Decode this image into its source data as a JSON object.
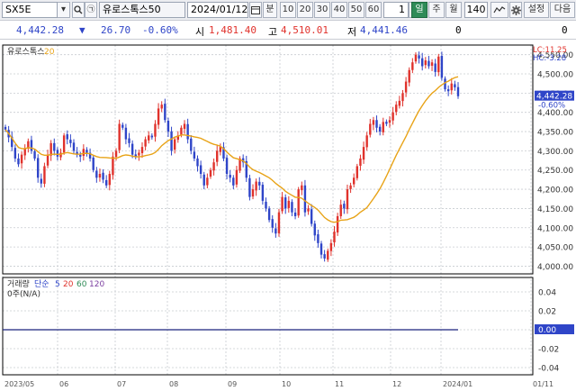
{
  "toolbar": {
    "symbol": "SX5E",
    "name": "유로스톡스50",
    "date": "2024/01/12",
    "period_label": "분",
    "intervals": [
      "10",
      "20",
      "30",
      "40",
      "50",
      "60"
    ],
    "count_value": "1",
    "period_tabs": [
      "일",
      "주",
      "월"
    ],
    "active_tab": "일",
    "bar_count": "140",
    "settings_label": "설정",
    "next_label": "다음"
  },
  "quote": {
    "price": "4,442.28",
    "change_arrow": "▼",
    "change": "26.70",
    "change_pct": "-0.60%",
    "open_label": "시",
    "open": "1,481.40",
    "high_label": "고",
    "high": "4,510.01",
    "low_label": "저",
    "low": "4,441.46",
    "volume_1": "0",
    "volume_2": "0"
  },
  "chart": {
    "legend_name": "유로스톡스",
    "legend_ma": "20",
    "lc_label": "LC:11.25",
    "hc_label": "HC:-3.28",
    "current_price_label": "4,442.28",
    "current_pct_label": "-0.60%",
    "price_ticks": [
      "4,550.00",
      "4,500.00",
      "4,450.00",
      "4,400.00",
      "4,350.00",
      "4,300.00",
      "4,250.00",
      "4,200.00",
      "4,150.00",
      "4,100.00",
      "4,050.00",
      "4,000.00"
    ],
    "volume_legend": {
      "label": "거래량",
      "type": "단순",
      "ma5": "5",
      "ma20": "20",
      "ma60": "60",
      "ma120": "120"
    },
    "volume_sub": "0주(N/A)",
    "volume_ticks": [
      "0.04",
      "0.02",
      "0",
      "-0.02",
      "-0.04"
    ],
    "volume_current": "0.00",
    "x_ticks": [
      "2023/05",
      "06",
      "07",
      "08",
      "09",
      "10",
      "11",
      "12",
      "2024/01",
      "01/11"
    ],
    "colors": {
      "up": "#e0322c",
      "down": "#2f45c8",
      "ma": "#e8a317",
      "grid": "#c8cbd0",
      "border": "#000000"
    }
  },
  "chart_data": {
    "type": "candlestick",
    "ylim": [
      3980,
      4575
    ],
    "closes": [
      4355,
      4335,
      4310,
      4280,
      4265,
      4290,
      4305,
      4325,
      4300,
      4280,
      4230,
      4215,
      4260,
      4290,
      4320,
      4300,
      4285,
      4295,
      4340,
      4330,
      4320,
      4300,
      4290,
      4285,
      4305,
      4295,
      4280,
      4250,
      4230,
      4240,
      4225,
      4210,
      4240,
      4285,
      4300,
      4370,
      4360,
      4330,
      4320,
      4290,
      4285,
      4295,
      4310,
      4330,
      4340,
      4335,
      4370,
      4410,
      4420,
      4380,
      4350,
      4300,
      4330,
      4340,
      4360,
      4370,
      4330,
      4300,
      4280,
      4260,
      4240,
      4210,
      4230,
      4250,
      4270,
      4300,
      4310,
      4280,
      4240,
      4230,
      4210,
      4250,
      4280,
      4270,
      4230,
      4180,
      4200,
      4220,
      4210,
      4170,
      4150,
      4120,
      4100,
      4085,
      4140,
      4180,
      4150,
      4170,
      4140,
      4130,
      4200,
      4210,
      4140,
      4150,
      4110,
      4080,
      4060,
      4030,
      4020,
      4040,
      4060,
      4090,
      4130,
      4160,
      4150,
      4200,
      4210,
      4230,
      4260,
      4280,
      4310,
      4340,
      4370,
      4380,
      4360,
      4350,
      4375,
      4370,
      4380,
      4400,
      4420,
      4430,
      4450,
      4480,
      4510,
      4530,
      4550,
      4540,
      4520,
      4535,
      4520,
      4530,
      4505,
      4545,
      4490,
      4460,
      4455,
      4475,
      4465,
      4442
    ]
  }
}
